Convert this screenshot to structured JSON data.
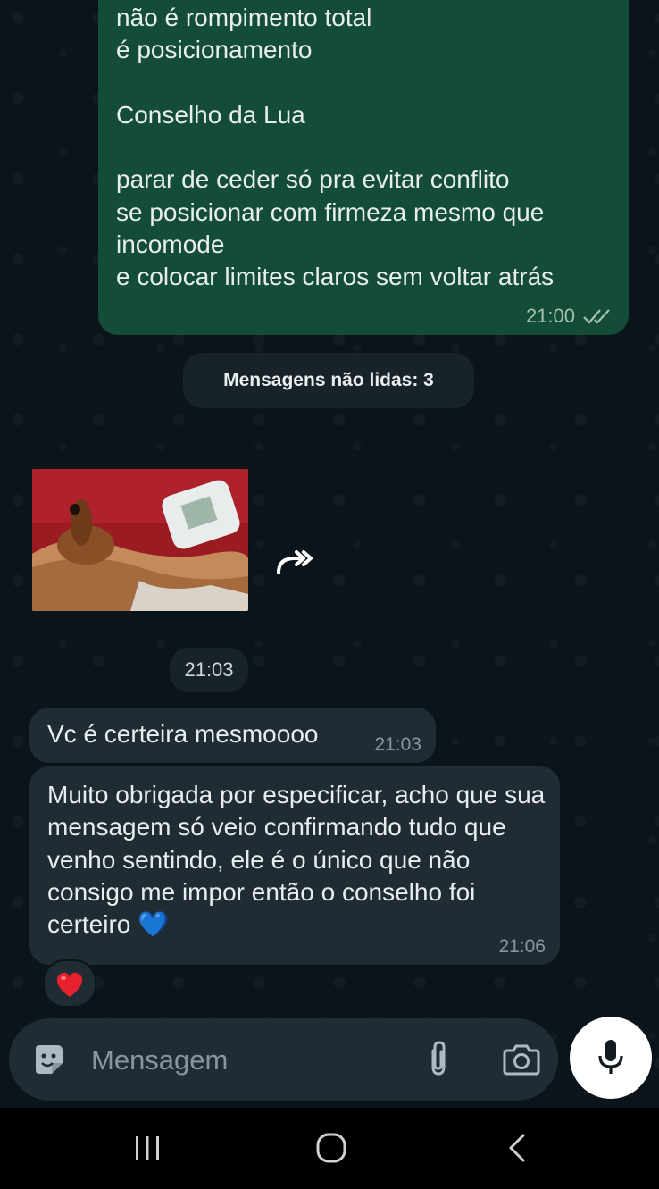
{
  "outgoing_message": {
    "text": "não é rompimento total\né posicionamento\n\nConselho da Lua\n\nparar de ceder só pra evitar conflito\nse posicionar com firmeza mesmo que incomode\ne colocar limites claros sem voltar atrás",
    "time": "21:00",
    "status_icon": "double-check-icon"
  },
  "unread_banner": "Mensagens não lidas: 3",
  "date_pill": "21:03",
  "incoming_messages": [
    {
      "text": "Vc é certeira mesmoooo",
      "time": "21:03"
    },
    {
      "text": "Muito obrigada por especificar, acho que sua mensagem só veio confirmando tudo que venho sentindo, ele é o único que não consigo me impor então o conselho foi certeiro 💙",
      "time": "21:06",
      "reaction": "❤️"
    }
  ],
  "composer": {
    "placeholder": "Mensagem",
    "icons": [
      "sticker-icon",
      "attach-icon",
      "camera-icon",
      "mic-icon"
    ]
  },
  "navbar": {
    "icons": [
      "recents-icon",
      "home-icon",
      "back-icon"
    ]
  },
  "colors": {
    "chat_background": "#0b141a",
    "outgoing_bubble": "#144d37",
    "incoming_bubble": "#202c33",
    "secondary_text": "#8696a0"
  }
}
